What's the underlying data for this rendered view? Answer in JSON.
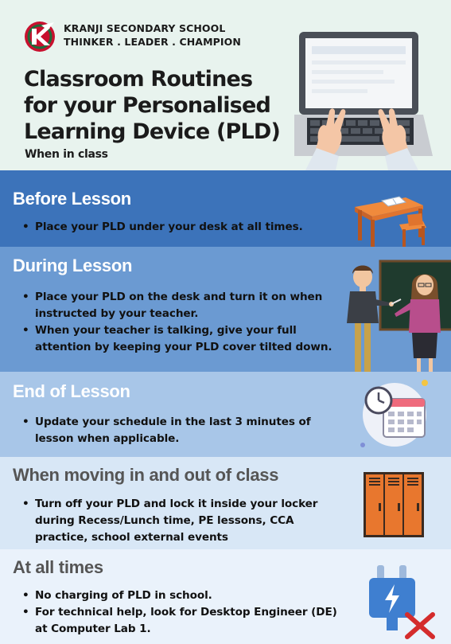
{
  "header": {
    "school_name": "KRANJI SECONDARY SCHOOL",
    "motto": "THINKER . LEADER . CHAMPION",
    "title_lines": [
      "Classroom Routines",
      "for your Personalised",
      "Learning Device (PLD)"
    ],
    "subtitle": "When in class"
  },
  "sections": [
    {
      "title": "Before Lesson",
      "bullets": [
        "Place your PLD under your desk at all times."
      ]
    },
    {
      "title": "During Lesson",
      "bullets": [
        "Place your PLD on the desk and turn it on when",
        "instructed by your teacher.",
        "When your teacher is talking, give your full",
        "attention by keeping your PLD cover tilted down."
      ]
    },
    {
      "title": "End of Lesson",
      "bullets": [
        "Update your schedule in the last 3 minutes of",
        "lesson when applicable."
      ]
    },
    {
      "title": "When moving in and out of class",
      "bullets": [
        "Turn off your PLD and lock it inside your locker",
        "during Recess/Lunch time, PE lessons, CCA",
        "practice, school external events"
      ]
    },
    {
      "title": "At all times",
      "bullets": [
        "No charging of PLD in school.",
        "For technical help, look for Desktop Engineer (DE)",
        "at Computer Lab 1."
      ]
    }
  ],
  "colors": {
    "header_bg": "#e8f3ee",
    "before_bg": "#3c73ba",
    "during_bg": "#6b9ad2",
    "end_bg": "#a8c6e8",
    "moving_bg": "#d8e7f6",
    "always_bg": "#eaf2fb",
    "logo_red": "#c8102e"
  },
  "icons": [
    "school-logo-icon",
    "laptop-hands-illustration",
    "desk-book-illustration",
    "teachers-blackboard-illustration",
    "clock-calendar-icon",
    "lockers-icon",
    "no-charging-plug-icon"
  ]
}
